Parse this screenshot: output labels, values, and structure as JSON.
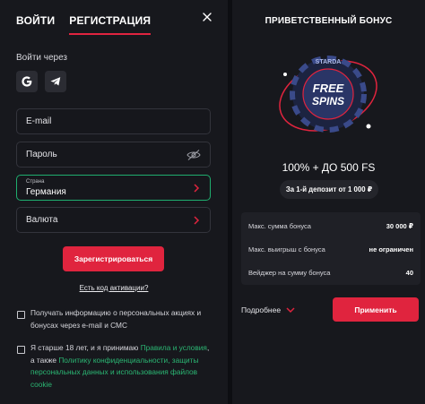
{
  "tabs": [
    {
      "label": "ВОЙТИ",
      "active": false
    },
    {
      "label": "РЕГИСТРАЦИЯ",
      "active": true
    }
  ],
  "login_via": "Войти через",
  "social": [
    "google-icon",
    "telegram-icon"
  ],
  "fields": {
    "email": "E-mail",
    "password": "Пароль",
    "country_label": "Страна",
    "country_value": "Германия",
    "currency": "Валюта"
  },
  "register_button": "Зарегистрироваться",
  "activation_link": "Есть код активации?",
  "consent1": "Получать информацию о персональных акциях и бонусах через e-mail и СМС",
  "consent2": {
    "part1": "Я старше 18 лет, и я принимаю ",
    "link1": "Правила и условия",
    "part2": ", а также ",
    "link2": "Политику конфиденциальности, защиты персональных данных и использования файлов cookie"
  },
  "bonus": {
    "title": "ПРИВЕТСТВЕННЫЙ БОНУС",
    "chip_line1": "FREE",
    "chip_line2": "SPINS",
    "chip_ring": "STARDA",
    "headline": "100% + ДО 500 FS",
    "deposit": "За 1-й депозит от 1 000 ₽",
    "rows": [
      {
        "label": "Макс. сумма бонуса",
        "value": "30 000 ₽"
      },
      {
        "label": "Макс. выигрыш с бонуса",
        "value": "не ограничен"
      },
      {
        "label": "Вейджер на сумму бонуса",
        "value": "40"
      }
    ],
    "more": "Подробнее",
    "apply": "Применить"
  },
  "colors": {
    "accent": "#e0243e",
    "green": "#2bb673",
    "panel": "#17181d"
  }
}
